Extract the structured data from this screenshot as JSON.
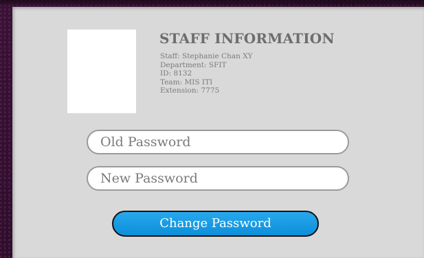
{
  "staff_info": {
    "title": "STAFF INFORMATION",
    "staff": "Staff: Stephanie Chan XY",
    "department": "Department: SFIT",
    "id": "ID: 8132",
    "team": "Team: MIS ITI",
    "extension": "Extension: 7775"
  },
  "form": {
    "old_password_placeholder": "Old Password",
    "old_password_value": "",
    "new_password_placeholder": "New Password",
    "new_password_value": "",
    "submit_label": "Change Password"
  },
  "colors": {
    "background": "#2e0f2b",
    "panel": "#d9d9d9",
    "button": "#1a9be3",
    "title_text": "#6d6d6d"
  }
}
